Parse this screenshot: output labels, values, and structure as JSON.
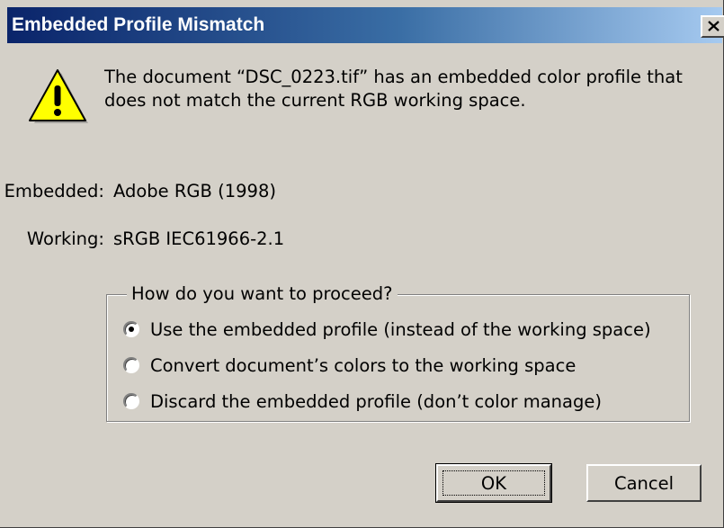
{
  "dialog": {
    "title": "Embedded Profile Mismatch",
    "close_icon": "close-x-icon",
    "warning_icon": "warning-triangle-icon",
    "message_line1": "The document “DSC_0223.tif” has an embedded color profile that",
    "message_line2": "does not match the current RGB working space.",
    "embedded_label": "Embedded:",
    "embedded_value": "Adobe RGB (1998)",
    "working_label": "Working:",
    "working_value": "sRGB IEC61966-2.1",
    "group_title": "How do you want to proceed?",
    "options": [
      {
        "label": "Use the embedded profile (instead of the working space)",
        "selected": true
      },
      {
        "label": "Convert document’s colors to the working space",
        "selected": false
      },
      {
        "label": "Discard the embedded profile (don’t color manage)",
        "selected": false
      }
    ],
    "ok_label": "OK",
    "cancel_label": "Cancel",
    "colors": {
      "title_start": "#0a246a",
      "title_end": "#a6caf0",
      "face": "#d4d0c8",
      "warning_yellow": "#ffff00"
    }
  }
}
